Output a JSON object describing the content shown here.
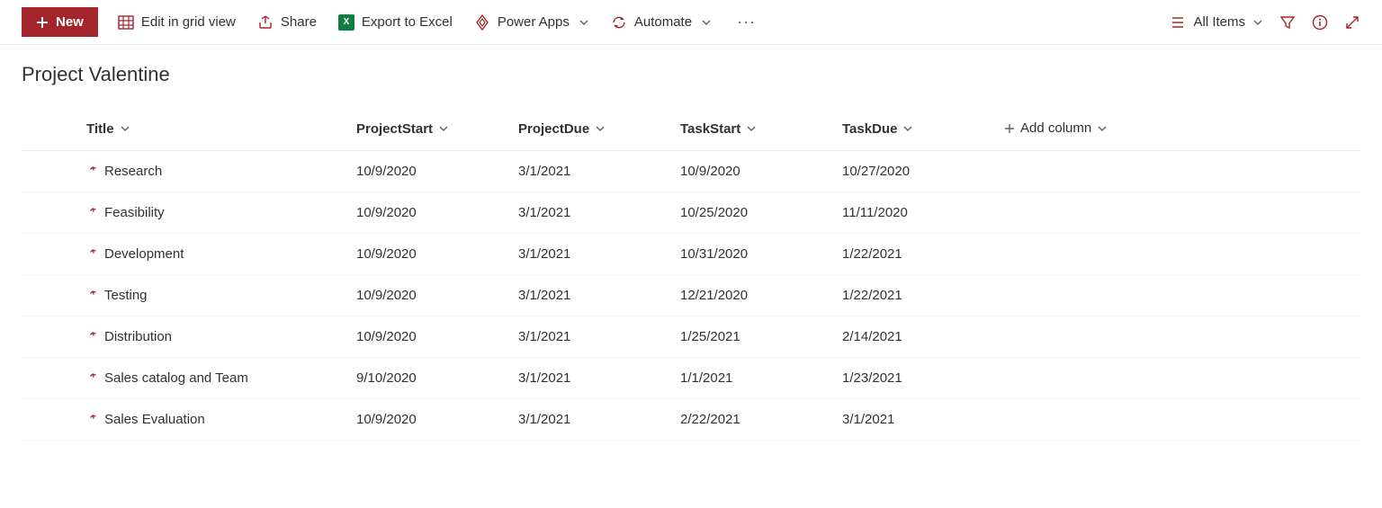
{
  "toolbar": {
    "new_label": "New",
    "edit_grid_label": "Edit in grid view",
    "share_label": "Share",
    "export_label": "Export to Excel",
    "power_apps_label": "Power Apps",
    "automate_label": "Automate",
    "view_label": "All Items"
  },
  "list": {
    "title": "Project Valentine",
    "columns": {
      "title": "Title",
      "project_start": "ProjectStart",
      "project_due": "ProjectDue",
      "task_start": "TaskStart",
      "task_due": "TaskDue",
      "add_column": "Add column"
    },
    "rows": [
      {
        "title": "Research",
        "project_start": "10/9/2020",
        "project_due": "3/1/2021",
        "task_start": "10/9/2020",
        "task_due": "10/27/2020"
      },
      {
        "title": "Feasibility",
        "project_start": "10/9/2020",
        "project_due": "3/1/2021",
        "task_start": "10/25/2020",
        "task_due": "11/11/2020"
      },
      {
        "title": "Development",
        "project_start": "10/9/2020",
        "project_due": "3/1/2021",
        "task_start": "10/31/2020",
        "task_due": "1/22/2021"
      },
      {
        "title": "Testing",
        "project_start": "10/9/2020",
        "project_due": "3/1/2021",
        "task_start": "12/21/2020",
        "task_due": "1/22/2021"
      },
      {
        "title": "Distribution",
        "project_start": "10/9/2020",
        "project_due": "3/1/2021",
        "task_start": "1/25/2021",
        "task_due": "2/14/2021"
      },
      {
        "title": "Sales catalog and Team",
        "project_start": "9/10/2020",
        "project_due": "3/1/2021",
        "task_start": "1/1/2021",
        "task_due": "1/23/2021"
      },
      {
        "title": "Sales Evaluation",
        "project_start": "10/9/2020",
        "project_due": "3/1/2021",
        "task_start": "2/22/2021",
        "task_due": "3/1/2021"
      }
    ]
  }
}
